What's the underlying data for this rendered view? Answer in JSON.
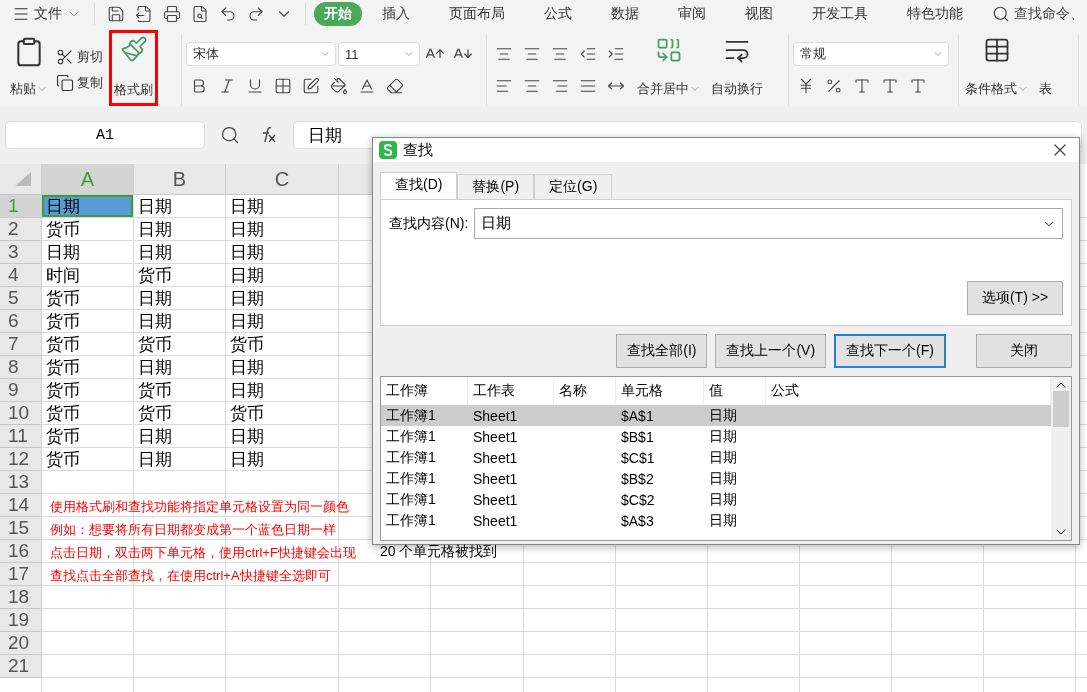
{
  "menu_bar": {
    "file_menu": "文件",
    "tabs": [
      {
        "label": "开始",
        "selected": true
      },
      {
        "label": "插入",
        "selected": false
      },
      {
        "label": "页面布局",
        "selected": false
      },
      {
        "label": "公式",
        "selected": false
      },
      {
        "label": "数据",
        "selected": false
      },
      {
        "label": "审阅",
        "selected": false
      },
      {
        "label": "视图",
        "selected": false
      },
      {
        "label": "开发工具",
        "selected": false
      },
      {
        "label": "特色功能",
        "selected": false
      }
    ],
    "search": {
      "placeholder": "查找命令、"
    }
  },
  "ribbon": {
    "paste": "粘贴",
    "cut": "剪切",
    "copy": "复制",
    "format_painter": "格式刷",
    "font_name": "宋体",
    "font_size": "11",
    "merge": "合并居中",
    "wrap": "自动换行",
    "number_format": "常规",
    "conditional_format": "条件格式",
    "table_format": "表"
  },
  "formula_bar": {
    "name_box": "A1",
    "formula": "日期"
  },
  "sheet": {
    "columns": [
      {
        "label": "A",
        "selected": true
      },
      {
        "label": "B",
        "selected": false
      },
      {
        "label": "C",
        "selected": false
      }
    ],
    "rows": [
      {
        "label": "1",
        "selected": true,
        "cells": [
          {
            "text": "日期",
            "selected": true
          },
          {
            "text": "日期",
            "selected": false
          },
          {
            "text": "日期",
            "selected": false
          }
        ]
      },
      {
        "label": "2",
        "selected": false,
        "cells": [
          {
            "text": "货币",
            "selected": false
          },
          {
            "text": "日期",
            "selected": false
          },
          {
            "text": "日期",
            "selected": false
          }
        ]
      },
      {
        "label": "3",
        "selected": false,
        "cells": [
          {
            "text": "日期",
            "selected": false
          },
          {
            "text": "日期",
            "selected": false
          },
          {
            "text": "日期",
            "selected": false
          }
        ]
      },
      {
        "label": "4",
        "selected": false,
        "cells": [
          {
            "text": "时间",
            "selected": false
          },
          {
            "text": "货币",
            "selected": false
          },
          {
            "text": "日期",
            "selected": false
          }
        ]
      },
      {
        "label": "5",
        "selected": false,
        "cells": [
          {
            "text": "货币",
            "selected": false
          },
          {
            "text": "日期",
            "selected": false
          },
          {
            "text": "日期",
            "selected": false
          }
        ]
      },
      {
        "label": "6",
        "selected": false,
        "cells": [
          {
            "text": "货币",
            "selected": false
          },
          {
            "text": "日期",
            "selected": false
          },
          {
            "text": "日期",
            "selected": false
          }
        ]
      },
      {
        "label": "7",
        "selected": false,
        "cells": [
          {
            "text": "货币",
            "selected": false
          },
          {
            "text": "货币",
            "selected": false
          },
          {
            "text": "货币",
            "selected": false
          }
        ]
      },
      {
        "label": "8",
        "selected": false,
        "cells": [
          {
            "text": "货币",
            "selected": false
          },
          {
            "text": "日期",
            "selected": false
          },
          {
            "text": "日期",
            "selected": false
          }
        ]
      },
      {
        "label": "9",
        "selected": false,
        "cells": [
          {
            "text": "货币",
            "selected": false
          },
          {
            "text": "货币",
            "selected": false
          },
          {
            "text": "日期",
            "selected": false
          }
        ]
      },
      {
        "label": "10",
        "selected": false,
        "cells": [
          {
            "text": "货币",
            "selected": false
          },
          {
            "text": "货币",
            "selected": false
          },
          {
            "text": "货币",
            "selected": false
          }
        ]
      },
      {
        "label": "11",
        "selected": false,
        "cells": [
          {
            "text": "货币",
            "selected": false
          },
          {
            "text": "日期",
            "selected": false
          },
          {
            "text": "日期",
            "selected": false
          }
        ]
      },
      {
        "label": "12",
        "selected": false,
        "cells": [
          {
            "text": "货币",
            "selected": false
          },
          {
            "text": "日期",
            "selected": false
          },
          {
            "text": "日期",
            "selected": false
          }
        ]
      },
      {
        "label": "13",
        "selected": false
      },
      {
        "label": "14",
        "selected": false
      },
      {
        "label": "15",
        "selected": false
      },
      {
        "label": "16",
        "selected": false
      },
      {
        "label": "17",
        "selected": false
      },
      {
        "label": "18",
        "selected": false
      },
      {
        "label": "19",
        "selected": false
      },
      {
        "label": "20",
        "selected": false
      },
      {
        "label": "21",
        "selected": false
      }
    ]
  },
  "annotation": {
    "lines": [
      "使用格式刷和查找功能将指定单元格设置为同一颜色",
      "例如：想要将所有日期都变成第一个蓝色日期一样",
      "点击日期，双击两下单元格，使用ctrl+F快捷键会出现",
      "查找点击全部查找，在使用ctrl+A快捷键全选即可"
    ]
  },
  "find_dialog": {
    "title": "查找",
    "tabs": [
      {
        "label": "查找(D)",
        "selected": true
      },
      {
        "label": "替换(P)",
        "selected": false
      },
      {
        "label": "定位(G)",
        "selected": false
      }
    ],
    "find_label": "查找内容(N):",
    "find_value": "日期",
    "options_button": "选项(T) >>",
    "buttons": [
      {
        "label": "查找全部(I)",
        "default": false
      },
      {
        "label": "查找上一个(V)",
        "default": false
      },
      {
        "label": "查找下一个(F)",
        "default": true
      }
    ],
    "close_button": "关闭",
    "results": {
      "columns": [
        "工作簿",
        "工作表",
        "名称",
        "单元格",
        "值",
        "公式"
      ],
      "rows": [
        {
          "selected": true,
          "cells": [
            "工作簿1",
            "Sheet1",
            "",
            "$A$1",
            "日期",
            ""
          ]
        },
        {
          "selected": false,
          "cells": [
            "工作簿1",
            "Sheet1",
            "",
            "$B$1",
            "日期",
            ""
          ]
        },
        {
          "selected": false,
          "cells": [
            "工作簿1",
            "Sheet1",
            "",
            "$C$1",
            "日期",
            ""
          ]
        },
        {
          "selected": false,
          "cells": [
            "工作簿1",
            "Sheet1",
            "",
            "$B$2",
            "日期",
            ""
          ]
        },
        {
          "selected": false,
          "cells": [
            "工作簿1",
            "Sheet1",
            "",
            "$C$2",
            "日期",
            ""
          ]
        },
        {
          "selected": false,
          "cells": [
            "工作簿1",
            "Sheet1",
            "",
            "$A$3",
            "日期",
            ""
          ]
        }
      ]
    },
    "status": "20 个单元格被找到"
  }
}
